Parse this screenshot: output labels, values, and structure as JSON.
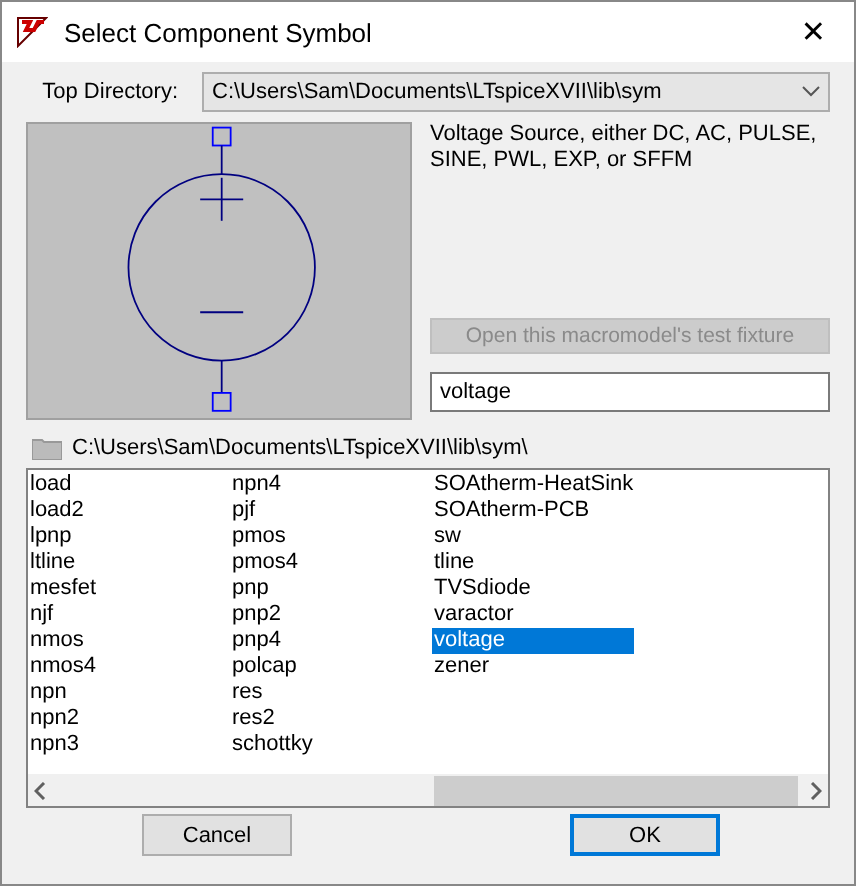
{
  "window": {
    "title": "Select Component Symbol",
    "close": "✕"
  },
  "top_directory": {
    "label": "Top Directory:",
    "value": "C:\\Users\\Sam\\Documents\\LTspiceXVII\\lib\\sym"
  },
  "description": "Voltage Source, either DC, AC, PULSE, SINE, PWL, EXP, or SFFM",
  "test_fixture_button": {
    "label": "Open this macromodel's test fixture",
    "disabled": true
  },
  "search": {
    "value": "voltage"
  },
  "current_path": "C:\\Users\\Sam\\Documents\\LTspiceXVII\\lib\\sym\\",
  "symbols": [
    {
      "name": "load",
      "selected": false
    },
    {
      "name": "load2",
      "selected": false
    },
    {
      "name": "lpnp",
      "selected": false
    },
    {
      "name": "ltline",
      "selected": false
    },
    {
      "name": "mesfet",
      "selected": false
    },
    {
      "name": "njf",
      "selected": false
    },
    {
      "name": "nmos",
      "selected": false
    },
    {
      "name": "nmos4",
      "selected": false
    },
    {
      "name": "npn",
      "selected": false
    },
    {
      "name": "npn2",
      "selected": false
    },
    {
      "name": "npn3",
      "selected": false
    },
    {
      "name": "npn4",
      "selected": false
    },
    {
      "name": "pjf",
      "selected": false
    },
    {
      "name": "pmos",
      "selected": false
    },
    {
      "name": "pmos4",
      "selected": false
    },
    {
      "name": "pnp",
      "selected": false
    },
    {
      "name": "pnp2",
      "selected": false
    },
    {
      "name": "pnp4",
      "selected": false
    },
    {
      "name": "polcap",
      "selected": false
    },
    {
      "name": "res",
      "selected": false
    },
    {
      "name": "res2",
      "selected": false
    },
    {
      "name": "schottky",
      "selected": false
    },
    {
      "name": "SOAtherm-HeatSink",
      "selected": false
    },
    {
      "name": "SOAtherm-PCB",
      "selected": false
    },
    {
      "name": "sw",
      "selected": false
    },
    {
      "name": "tline",
      "selected": false
    },
    {
      "name": "TVSdiode",
      "selected": false
    },
    {
      "name": "varactor",
      "selected": false
    },
    {
      "name": "voltage",
      "selected": true
    },
    {
      "name": "zener",
      "selected": false
    }
  ],
  "buttons": [
    {
      "label": "Cancel",
      "default": false
    },
    {
      "label": "OK",
      "default": true
    }
  ]
}
